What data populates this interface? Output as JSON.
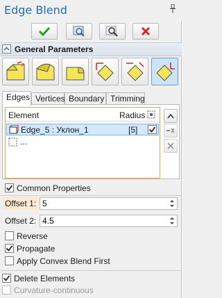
{
  "window": {
    "title": "Edge Blend"
  },
  "actions": [
    {
      "name": "ok-button",
      "icon": "checkmark-icon"
    },
    {
      "name": "preview-button",
      "icon": "preview-icon"
    },
    {
      "name": "zoom-preview-button",
      "icon": "magnifier-icon"
    },
    {
      "name": "cancel-button",
      "icon": "red-x-icon"
    }
  ],
  "section": {
    "title": "General Parameters"
  },
  "modes": [
    {
      "icon": "blend-mode-1-icon",
      "active": false
    },
    {
      "icon": "blend-mode-2-icon",
      "active": false
    },
    {
      "icon": "blend-mode-3-icon",
      "active": false
    },
    {
      "icon": "blend-mode-4-icon",
      "active": false
    },
    {
      "icon": "blend-mode-5-icon",
      "active": false
    },
    {
      "icon": "blend-mode-6-icon",
      "active": true
    }
  ],
  "tabs": [
    "Edges",
    "Vertices",
    "Boundary",
    "Trimming"
  ],
  "active_tab": "Edges",
  "edges_list": {
    "col_element": "Element",
    "col_radius": "Radius",
    "rows": [
      {
        "element": "Edge_5 : Уклон_1",
        "radius": "[5]",
        "checked": true,
        "selected": true
      },
      {
        "element": "...",
        "radius": "",
        "checked": false,
        "selected": false
      }
    ]
  },
  "common_properties": {
    "label": "Common Properties",
    "checked": true
  },
  "offset1": {
    "label": "Offset 1:",
    "value": "5"
  },
  "offset2": {
    "label": "Offset 2:",
    "value": "4.5"
  },
  "reverse": {
    "label": "Reverse",
    "checked": false
  },
  "propagate": {
    "label": "Propagate",
    "checked": true
  },
  "convex": {
    "label": "Apply Convex Blend First",
    "checked": false
  },
  "delete_elements": {
    "label": "Delete Elements",
    "checked": true
  },
  "curvature": {
    "label": "Curvature-continuous",
    "checked": false,
    "disabled": true
  },
  "colors": {
    "title": "#1d6fb8",
    "accent": "#e0a15a",
    "selection": "#d3e8fb"
  }
}
